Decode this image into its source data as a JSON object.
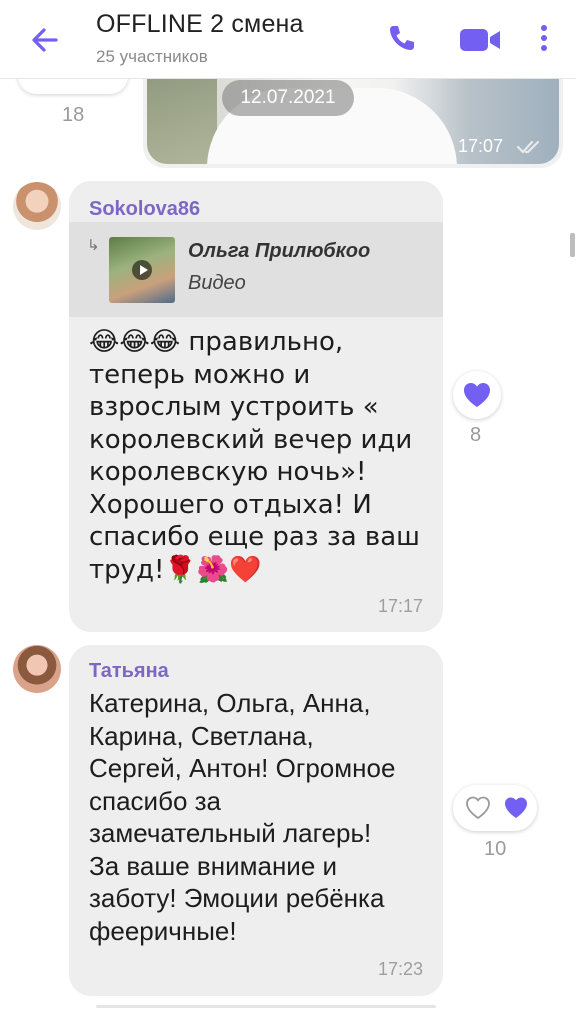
{
  "header": {
    "title": "OFFLINE 2 смена",
    "subtitle": "25 участников",
    "accent": "#7360f2"
  },
  "top": {
    "reaction_count": "18",
    "date": "12.07.2021",
    "photo_time": "17:07"
  },
  "messages": [
    {
      "sender": "Sokolova86",
      "quote_name": "Ольга Прилюбкоо",
      "quote_type": "Видео",
      "text": "😂😂😂 правильно,\nтеперь можно и\nвзрослым устроить «\nкоролевский вечер иди\nкоролевскую ночь»!\nХорошего отдыха! И\nспасибо еще раз за ваш\nтруд!🌹🌺❤️",
      "time": "17:17",
      "reaction_count": "8"
    },
    {
      "sender": "Татьяна",
      "text": "Катерина, Ольга, Анна,\nКарина, Светлана,\nСергей, Антон! Огромное\nспасибо за\nзамечательный лагерь!\nЗа ваше внимание и\nзаботу! Эмоции ребёнка\nфееричные!",
      "time": "17:23",
      "reaction_count": "10"
    }
  ],
  "icons": [
    "back-arrow-icon",
    "phone-icon",
    "video-camera-icon",
    "more-vertical-icon",
    "heart-icon",
    "heart-outline-icon",
    "double-check-icon",
    "play-icon",
    "reply-arrow-icon"
  ],
  "colors": {
    "bubble": "#eeeeee",
    "quote": "#e0e0e0",
    "sender": "#7c68c4",
    "heart": "#7360f2"
  }
}
